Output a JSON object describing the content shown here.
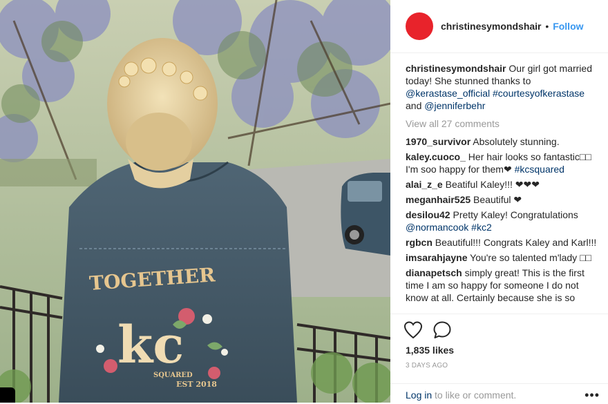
{
  "post": {
    "author": "christinesymondshair",
    "follow_dot": "•",
    "follow": "Follow",
    "jacket_text_top": "TOGETHER",
    "jacket_text_initials": "kc",
    "jacket_text_small": "SQUARED",
    "jacket_text_date": "EST 2018"
  },
  "caption": {
    "user": "christinesymondshair",
    "text1": " Our girl got married today! She stunned thanks to ",
    "mention1": "@kerastase_official",
    "space": " ",
    "hashtag1": "#courtesyofkerastase",
    "and": " and ",
    "mention2": "@jenniferbehr"
  },
  "view_all": "View all 27 comments",
  "comments": [
    {
      "user": "1970_survivor",
      "text": " Absolutely stunning."
    },
    {
      "user": "kaley.cuoco_",
      "text": " Her hair looks so fantastic□□ I'm soo happy for them❤ ",
      "tag": "#kcsquared"
    },
    {
      "user": "alai_z_e",
      "text": " Beatiful Kaley!!! ❤❤❤"
    },
    {
      "user": "meganhair525",
      "text": " Beautiful ❤"
    },
    {
      "user": "desilou42",
      "text": " Pretty Kaley! Congratulations ",
      "mention": "@normancook",
      "tag": "#kc2"
    },
    {
      "user": "rgbcn",
      "text": " Beautiful!!! Congrats Kaley and Karl!!!"
    },
    {
      "user": "imsarahjayne",
      "text": " You're so talented m'lady □□"
    },
    {
      "user": "dianapetsch",
      "text": " simply great! This is the first time I am so happy for someone I do not know at all. Certainly because she is so"
    }
  ],
  "actions": {
    "heart_icon": "heart-icon",
    "comment_icon": "comment-icon",
    "likes": "1,835 likes",
    "time": "3 DAYS AGO"
  },
  "footer": {
    "login": "Log in",
    "login_rest": " to like or comment.",
    "more": "•••"
  },
  "colors": {
    "avatar": "#e8232b",
    "link": "#003569",
    "follow": "#3897f0",
    "muted": "#999999"
  }
}
